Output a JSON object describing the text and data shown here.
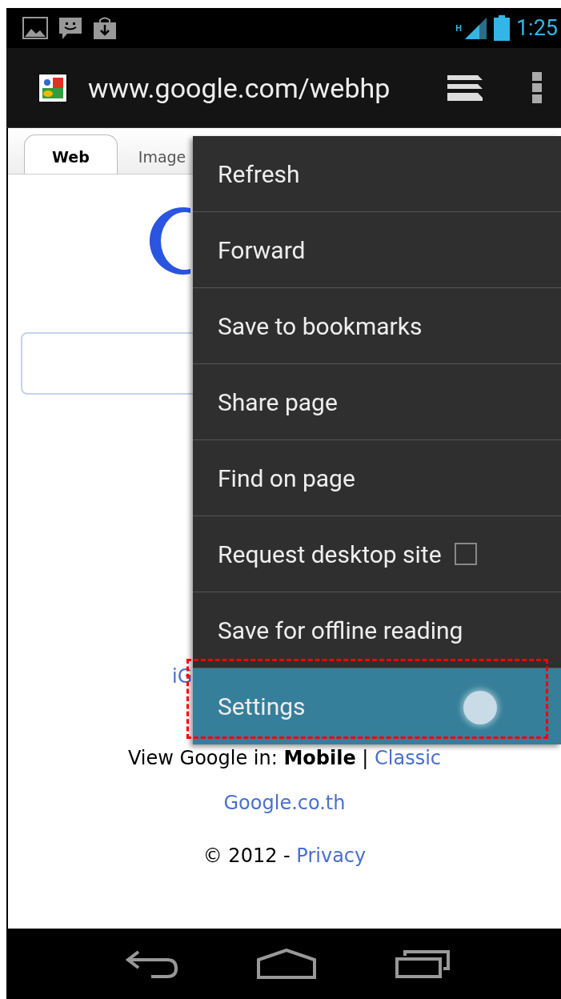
{
  "status_bar": {
    "network": "H",
    "time": "1:25"
  },
  "address_bar": {
    "url": "www.google.com/webhp"
  },
  "tabs": [
    {
      "label": "Web",
      "selected": true
    },
    {
      "label": "Image",
      "selected": false
    }
  ],
  "page": {
    "ig_link": "iG",
    "view_line": {
      "text": "View Google in: **Mobile** |",
      "link": "Classic"
    },
    "domain_link": "Google.co.th",
    "footer": {
      "copyright": "© 2012 -",
      "link": "Privacy"
    }
  },
  "menu": [
    {
      "label": "Refresh",
      "kind": "item",
      "selected": false
    },
    {
      "label": "Forward",
      "kind": "item",
      "selected": false
    },
    {
      "label": "Save to bookmarks",
      "kind": "item",
      "selected": false
    },
    {
      "label": "Share page",
      "kind": "item",
      "selected": false
    },
    {
      "label": "Find on page",
      "kind": "item",
      "selected": false
    },
    {
      "label": "Request desktop site",
      "kind": "checkbox",
      "checked": false,
      "selected": false
    },
    {
      "label": "Save for offline reading",
      "kind": "item",
      "selected": false
    },
    {
      "label": "Settings",
      "kind": "item",
      "selected": true
    }
  ]
}
